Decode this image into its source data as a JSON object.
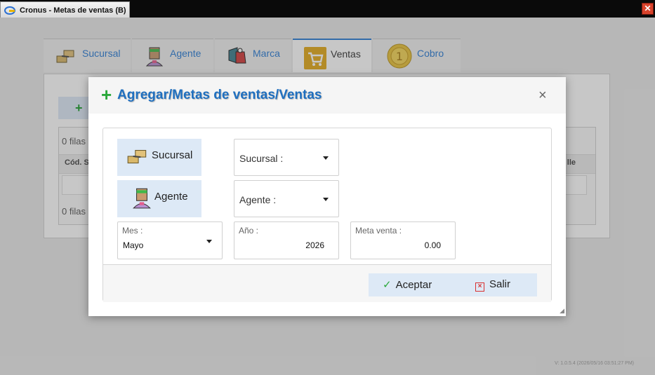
{
  "window": {
    "title": "Cronus - Metas de ventas (B)"
  },
  "nav_tabs": [
    {
      "label": "Sucursal",
      "icon": "branch-icon"
    },
    {
      "label": "Agente",
      "icon": "agent-icon"
    },
    {
      "label": "Marca",
      "icon": "brand-icon"
    },
    {
      "label": "Ventas",
      "icon": "cart-icon",
      "active": true
    },
    {
      "label": "Cobro",
      "icon": "coin-icon"
    }
  ],
  "panel": {
    "rows_top": "0 filas",
    "header_left": "Cód. S",
    "header_right": "lle",
    "rows_bottom": "0 filas"
  },
  "modal": {
    "title": "Agregar/Metas de ventas/Ventas",
    "sucursal_button": "Sucursal",
    "agente_button": "Agente",
    "sucursal_select": "Sucursal :",
    "agente_select": "Agente :",
    "mes": {
      "label": "Mes :",
      "value": "Mayo"
    },
    "anio": {
      "label": "Año :",
      "value": "2026"
    },
    "meta": {
      "label": "Meta venta :",
      "value": "0.00"
    },
    "accept": "Aceptar",
    "exit": "Salir"
  },
  "version": "V: 1.0.5.4 (2026/05/16 03:51:27 PM)",
  "colors": {
    "accent": "#2a7bd4",
    "button_bg": "#dde9f6",
    "titlebar": "#0a0a0a"
  }
}
